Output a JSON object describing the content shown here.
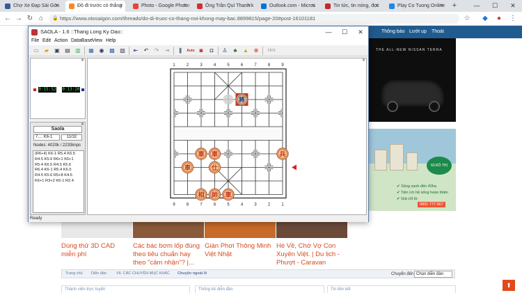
{
  "browser": {
    "tabs": [
      {
        "label": "Chợ Xe Đạp Sài Gòn",
        "color": "#3b5998",
        "active": false
      },
      {
        "label": "Đồ đi trước có thắng",
        "color": "#f28c28",
        "active": true
      },
      {
        "label": "Photo - Google Photos",
        "color": "#ea4335",
        "active": false
      },
      {
        "label": "Ông Trần Quí Thanh k",
        "color": "#d32f2f",
        "active": false
      },
      {
        "label": "Outlook.com - Micros",
        "color": "#0078d4",
        "active": false
      },
      {
        "label": "Tin tức, tin nóng, đọc",
        "color": "#c62828",
        "active": false
      },
      {
        "label": "Play Co Tuong Online",
        "color": "#1e88e5",
        "active": false
      }
    ],
    "new_tab": "+",
    "controls": {
      "minimize": "—",
      "maximize": "☐",
      "close": "✕"
    },
    "nav": {
      "back": "←",
      "forward": "→",
      "reload": "↻",
      "home": "⌂"
    },
    "url": "https://www.otosaigon.com/threads/do-di-truoc-co-thang-noi-khong-may-bac.8899815/page-20#post-16101181",
    "star": "☆"
  },
  "website": {
    "nav_items": [
      "Thông báo",
      "Lướt up",
      "Thoát"
    ],
    "ad_car_brand": "THE ALL-NEW NISSAN  TERRA",
    "ad_estate_lines": [
      "✔ Sông xanh đến 40ha",
      "✔ Tiện ích hệ sống hoàn thiện",
      "✔ Giá chỉ từ"
    ],
    "ad_estate_phone": "0901 777 667",
    "ad_estate_logo": "60 ĐÔ THỊ",
    "thumb_titles": [
      "Dùng thử 3D CAD miễn phí",
      "Các bác bơm lốp đúng theo tiêu chuẩn hay theo \"cảm nhận\"? |...",
      "Giàn Phơi Thông Minh Việt Nhật",
      "Hè Về, Chớ Vợ Con Xuyên Việt. | Du lịch - Phượt - Caravan"
    ],
    "breadcrumb": [
      "Trang chủ",
      "Diễn đàn",
      "VII. CÁC CHUYÊN MỤC KHÁC",
      "Chuyện ngoài lề"
    ],
    "jump_label": "Chuyển đến",
    "jump_value": "Chọn diễn đàn",
    "bottom_boxes": [
      "Thành viên trực tuyến",
      "Thống kê diễn đàn",
      "Tin liên kết"
    ],
    "scroll_top": "⬆"
  },
  "app": {
    "title": "SAOLA - 1.6 ::Thang Long Ky Dao::",
    "menu": [
      "File",
      "Edit",
      "Action",
      "DataBase",
      "View",
      "Help"
    ],
    "toolbar_hint": "Hint",
    "clocks": {
      "red": "0:15:52",
      "black": "0:13:20"
    },
    "engine": {
      "name": "Saola",
      "move": "7.... K6-1",
      "count": "11/32",
      "nodes": "Nodes: 4020k / 2233knps",
      "pv": [
        "(R6+4) K6-1 R5.4 K6.5",
        "R4.5 K5.6 R6+1 K6+1",
        "R5.4 K6.5 R4.5 K5.6",
        "R6.4 K6-1 R5.4 K6.5",
        "R4.5 K5.6 R5+8 K4.5",
        "K6+1 R3+2 K6-1 R2.4"
      ]
    },
    "status": "Ready",
    "board": {
      "top_files": [
        "1",
        "2",
        "3",
        "4",
        "5",
        "6",
        "7",
        "8",
        "9"
      ],
      "bottom_files": [
        "9",
        "8",
        "7",
        "6",
        "5",
        "4",
        "3",
        "2",
        "1"
      ],
      "colors": {
        "red": "#c0392b",
        "black": "#1c3f8a",
        "piece_bg": "#f7c68a",
        "highlight": "#cc3322",
        "arrow": "#e02020"
      },
      "pieces": [
        {
          "label": "將",
          "side": "black",
          "file": 6,
          "rank": 2,
          "selected": true
        },
        {
          "label": "兵",
          "side": "red",
          "file": 9,
          "rank": 6
        },
        {
          "label": "車",
          "side": "red",
          "file": 3,
          "rank": 6
        },
        {
          "label": "車",
          "side": "red",
          "file": 4,
          "rank": 6
        },
        {
          "label": "車",
          "side": "red",
          "file": 2,
          "rank": 7
        },
        {
          "label": "仕",
          "side": "red",
          "file": 4,
          "rank": 7
        },
        {
          "label": "相",
          "side": "red",
          "file": 3,
          "rank": 9
        },
        {
          "label": "帥",
          "side": "red",
          "file": 4,
          "rank": 9
        },
        {
          "label": "車",
          "side": "red",
          "file": 5,
          "rank": 9
        }
      ],
      "ghost": {
        "file": 5,
        "rank": 2
      }
    }
  }
}
